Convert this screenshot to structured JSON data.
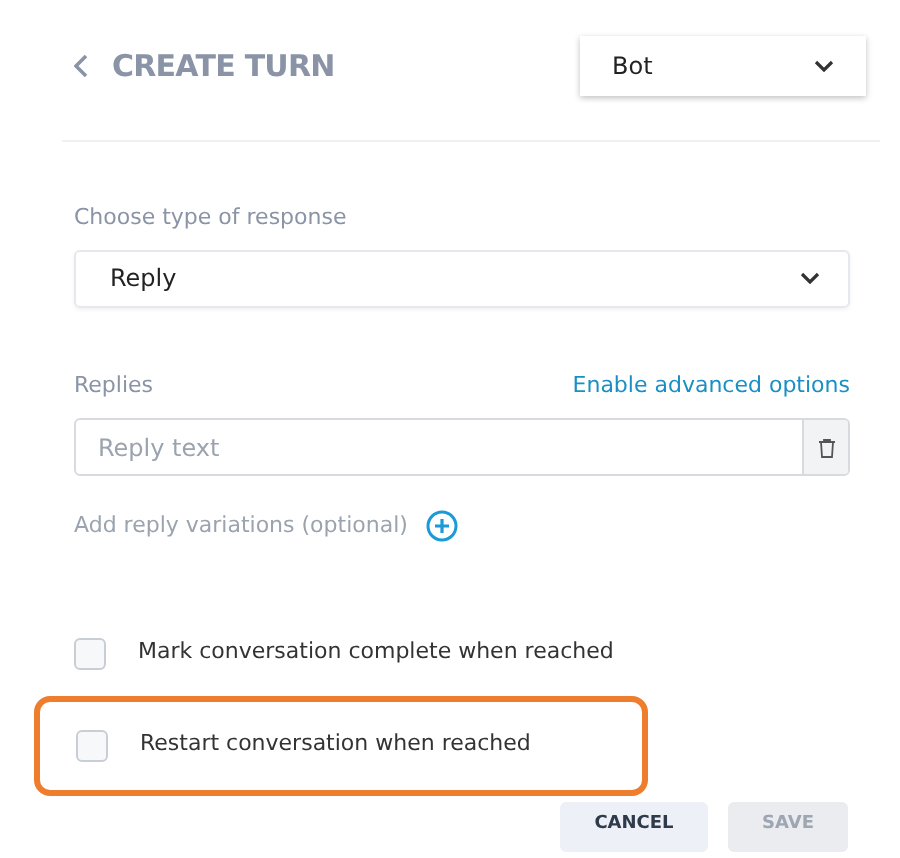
{
  "header": {
    "title": "CREATE TURN",
    "speaker_select": {
      "value": "Bot"
    }
  },
  "response_type": {
    "label": "Choose type of response",
    "value": "Reply"
  },
  "replies": {
    "label": "Replies",
    "link": "Enable advanced options",
    "placeholder": "Reply text"
  },
  "add_variations": {
    "label": "Add reply variations (optional)"
  },
  "options": [
    {
      "label": "Mark conversation complete when reached",
      "checked": false,
      "highlighted": false
    },
    {
      "label": "Restart conversation when reached",
      "checked": false,
      "highlighted": true
    }
  ],
  "buttons": [
    {
      "label": "CANCEL",
      "disabled": false
    },
    {
      "label": "SAVE",
      "disabled": true
    }
  ]
}
